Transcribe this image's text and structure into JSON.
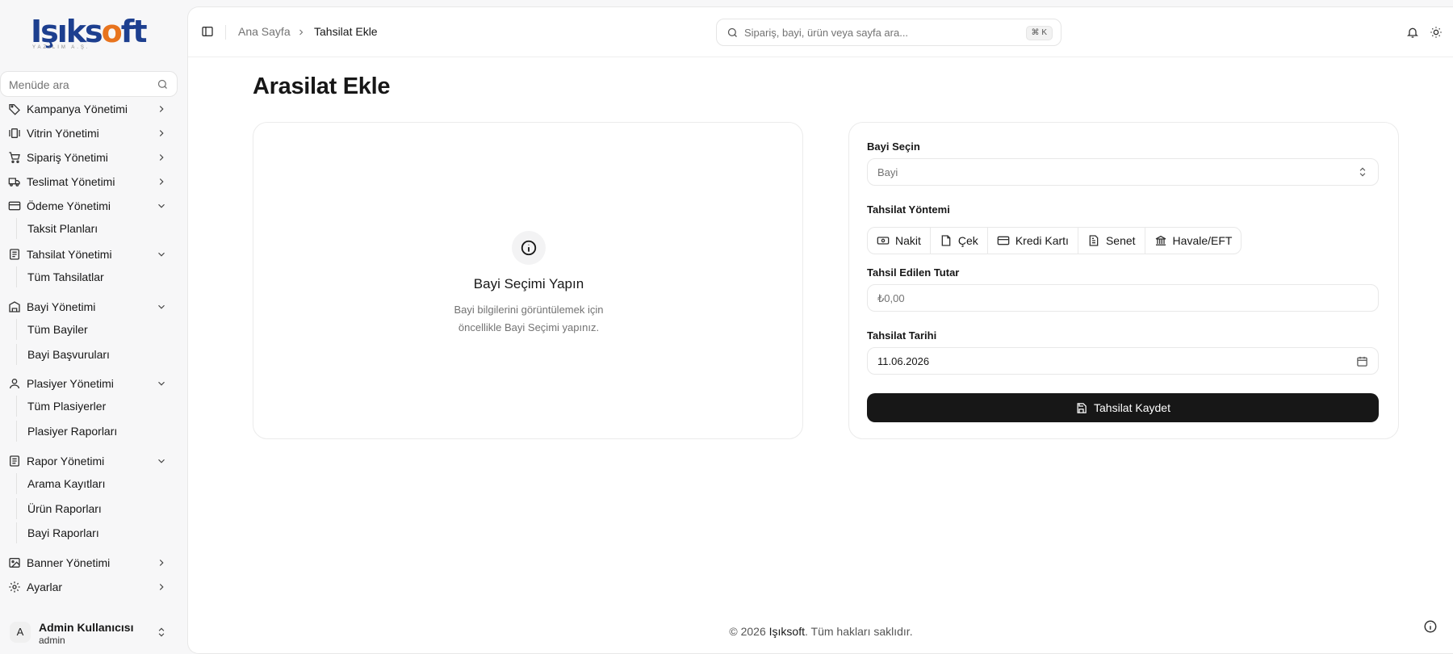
{
  "brand": {
    "logo_main": "Işıks",
    "logo_o": "o",
    "logo_end": "ft",
    "logo_sub": "YAZILIM A.Ş."
  },
  "sidebar": {
    "search_placeholder": "Menüde ara",
    "items": [
      {
        "label": "Kampanya Yönetimi",
        "icon": "tag-icon",
        "expanded": false
      },
      {
        "label": "Vitrin Yönetimi",
        "icon": "gallery-icon",
        "expanded": false
      },
      {
        "label": "Sipariş Yönetimi",
        "icon": "cart-icon",
        "expanded": false
      },
      {
        "label": "Teslimat Yönetimi",
        "icon": "truck-icon",
        "expanded": false
      },
      {
        "label": "Ödeme Yönetimi",
        "icon": "card-icon",
        "expanded": true,
        "children": [
          "Taksit Planları"
        ]
      },
      {
        "label": "Tahsilat Yönetimi",
        "icon": "receipt-icon",
        "expanded": true,
        "children": [
          "Tüm Tahsilatlar"
        ]
      },
      {
        "label": "Bayi Yönetimi",
        "icon": "building-icon",
        "expanded": true,
        "children": [
          "Tüm Bayiler",
          "Bayi Başvuruları"
        ]
      },
      {
        "label": "Plasiyer Yönetimi",
        "icon": "user-icon",
        "expanded": true,
        "children": [
          "Tüm Plasiyerler",
          "Plasiyer Raporları"
        ]
      },
      {
        "label": "Rapor Yönetimi",
        "icon": "report-icon",
        "expanded": true,
        "children": [
          "Arama Kayıtları",
          "Ürün Raporları",
          "Bayi Raporları"
        ]
      },
      {
        "label": "Banner Yönetimi",
        "icon": "image-icon",
        "expanded": false
      },
      {
        "label": "Ayarlar",
        "icon": "settings-icon",
        "expanded": false
      }
    ],
    "user": {
      "initial": "A",
      "name": "Admin Kullanıcısı",
      "role": "admin"
    }
  },
  "header": {
    "breadcrumb_home": "Ana Sayfa",
    "breadcrumb_current": "Tahsilat Ekle",
    "search_placeholder": "Sipariş, bayi, ürün veya sayfa ara...",
    "search_shortcut": "⌘ K"
  },
  "page": {
    "title": "Arasilat Ekle"
  },
  "empty_state": {
    "title": "Bayi Seçimi Yapın",
    "description": "Bayi bilgilerini görüntülemek için öncellikle Bayi Seçimi yapınız."
  },
  "form": {
    "dealer_label": "Bayi Seçin",
    "dealer_placeholder": "Bayi",
    "method_label": "Tahsilat Yöntemi",
    "methods": [
      "Nakit",
      "Çek",
      "Kredi Kartı",
      "Senet",
      "Havale/EFT"
    ],
    "amount_label": "Tahsil Edilen Tutar",
    "amount_placeholder": "₺0,00",
    "date_label": "Tahsilat Tarihi",
    "date_value": "11.06.2026",
    "submit_label": "Tahsilat Kaydet"
  },
  "footer": {
    "prefix": "© 2026 ",
    "brand": "Işıksoft",
    "suffix": ". Tüm hakları saklıdır."
  }
}
